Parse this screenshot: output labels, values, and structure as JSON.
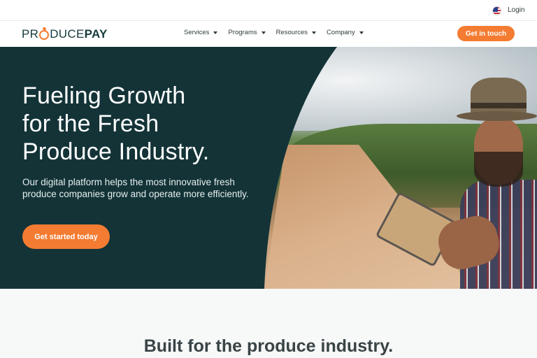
{
  "utility": {
    "flag_icon": "us-flag-icon",
    "login_label": "Login"
  },
  "brand": {
    "logo_prefix": "PR",
    "logo_middle": "DUCE",
    "logo_suffix": "PAY",
    "accent_color": "#f47c32",
    "dark_color": "#133337"
  },
  "nav": {
    "items": [
      {
        "label": "Services"
      },
      {
        "label": "Programs"
      },
      {
        "label": "Resources"
      },
      {
        "label": "Company"
      }
    ],
    "cta_label": "Get in touch"
  },
  "hero": {
    "title_line1": "Fueling Growth",
    "title_line2": "for the Fresh",
    "title_line3": "Produce Industry.",
    "subtitle": "Our digital platform helps the most innovative fresh produce companies grow and operate more efficiently.",
    "cta_label": "Get started today"
  },
  "section": {
    "title": "Built for the produce industry."
  }
}
